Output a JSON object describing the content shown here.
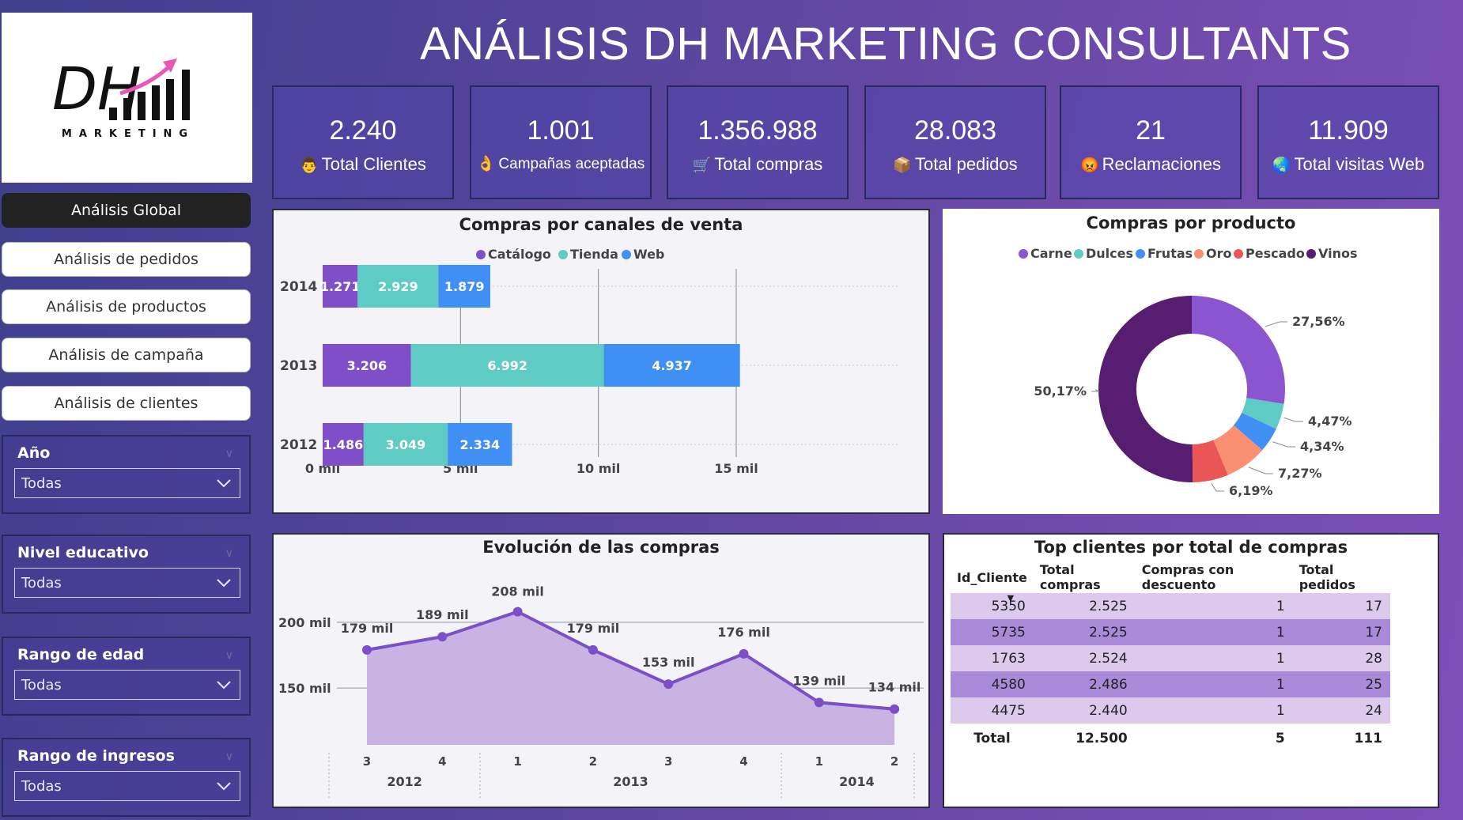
{
  "title": "ANÁLISIS  DH MARKETING CONSULTANTS",
  "logo": {
    "brand": "DH",
    "sub": "MARKETING"
  },
  "nav": [
    {
      "label": "Análisis Global",
      "active": true
    },
    {
      "label": "Análisis de pedidos",
      "active": false
    },
    {
      "label": "Análisis de productos",
      "active": false
    },
    {
      "label": "Análisis de campaña",
      "active": false
    },
    {
      "label": "Análisis de clientes",
      "active": false
    }
  ],
  "filters": [
    {
      "label": "Año",
      "value": "Todas"
    },
    {
      "label": "Nivel educativo",
      "value": "Todas"
    },
    {
      "label": "Rango de edad",
      "value": "Todas"
    },
    {
      "label": "Rango de ingresos",
      "value": "Todas"
    }
  ],
  "kpis": [
    {
      "value": "2.240",
      "label": "Total Clientes",
      "icon": "person-icon"
    },
    {
      "value": "1.001",
      "label": "Campañas aceptadas",
      "icon": "ok-hand-icon"
    },
    {
      "value": "1.356.988",
      "label": "Total compras",
      "icon": "cart-icon"
    },
    {
      "value": "28.083",
      "label": "Total pedidos",
      "icon": "package-icon"
    },
    {
      "value": "21",
      "label": "Reclamaciones",
      "icon": "angry-face-icon"
    },
    {
      "value": "11.909",
      "label": "Total visitas Web",
      "icon": "globe-icon"
    }
  ],
  "colors": {
    "catalogo": "#7e4fc8",
    "tienda": "#5ecbc4",
    "web": "#3f8ff5",
    "carne": "#8a55cf",
    "dulces": "#5ecbc4",
    "frutas": "#3f8ff5",
    "oro": "#fb8f72",
    "pescado": "#ea5656",
    "vinos": "#561d70",
    "line": "#7a4fc8",
    "area": "#c8b3e3"
  },
  "chart_data": [
    {
      "type": "bar",
      "orientation": "horizontal-stacked",
      "title": "Compras por canales de venta",
      "categories": [
        "2014",
        "2013",
        "2012"
      ],
      "series": [
        {
          "name": "Catálogo",
          "values": [
            1271,
            3206,
            1486
          ],
          "labels": [
            "1.271",
            "3.206",
            "1.486"
          ]
        },
        {
          "name": "Tienda",
          "values": [
            2929,
            6992,
            3049
          ],
          "labels": [
            "2.929",
            "6.992",
            "3.049"
          ]
        },
        {
          "name": "Web",
          "values": [
            1879,
            4937,
            2334
          ],
          "labels": [
            "1.879",
            "4.937",
            "2.334"
          ]
        }
      ],
      "xlim": [
        0,
        16000
      ],
      "xticks": [
        0,
        5000,
        10000,
        15000
      ],
      "xtick_labels": [
        "0 mil",
        "5 mil",
        "10 mil",
        "15 mil"
      ],
      "legend": "top-center"
    },
    {
      "type": "pie",
      "donut": true,
      "title": "Compras por producto",
      "categories": [
        "Carne",
        "Dulces",
        "Frutas",
        "Oro",
        "Pescado",
        "Vinos"
      ],
      "values": [
        27.56,
        4.47,
        4.34,
        7.27,
        6.19,
        50.17
      ],
      "labels": [
        "27,56%",
        "4,47%",
        "4,34%",
        "7,27%",
        "6,19%",
        "50,17%"
      ],
      "legend": "top-center"
    },
    {
      "type": "area",
      "title": "Evolución de las compras",
      "x": [
        "3",
        "4",
        "1",
        "2",
        "3",
        "4",
        "1",
        "2"
      ],
      "year_groups": [
        {
          "year": "2012",
          "span": 2
        },
        {
          "year": "2013",
          "span": 4
        },
        {
          "year": "2014",
          "span": 2
        }
      ],
      "values": [
        179000,
        189000,
        208000,
        179000,
        153000,
        176000,
        139000,
        134000
      ],
      "labels": [
        "179 mil",
        "189 mil",
        "208 mil",
        "179 mil",
        "153 mil",
        "176 mil",
        "139 mil",
        "134 mil"
      ],
      "ylim": [
        120000,
        215000
      ],
      "yticks": [
        150000,
        200000
      ],
      "ytick_labels": [
        "150 mil",
        "200 mil"
      ],
      "grid": true
    },
    {
      "type": "table",
      "title": "Top clientes por total de compras",
      "columns": [
        "Id_Cliente",
        "Total compras",
        "Compras con descuento",
        "Total pedidos"
      ],
      "rows": [
        [
          "5350",
          "2.525",
          "1",
          "17"
        ],
        [
          "5735",
          "2.525",
          "1",
          "17"
        ],
        [
          "1763",
          "2.524",
          "1",
          "28"
        ],
        [
          "4580",
          "2.486",
          "1",
          "25"
        ],
        [
          "4475",
          "2.440",
          "1",
          "24"
        ]
      ],
      "total": [
        "Total",
        "12.500",
        "5",
        "111"
      ]
    }
  ]
}
